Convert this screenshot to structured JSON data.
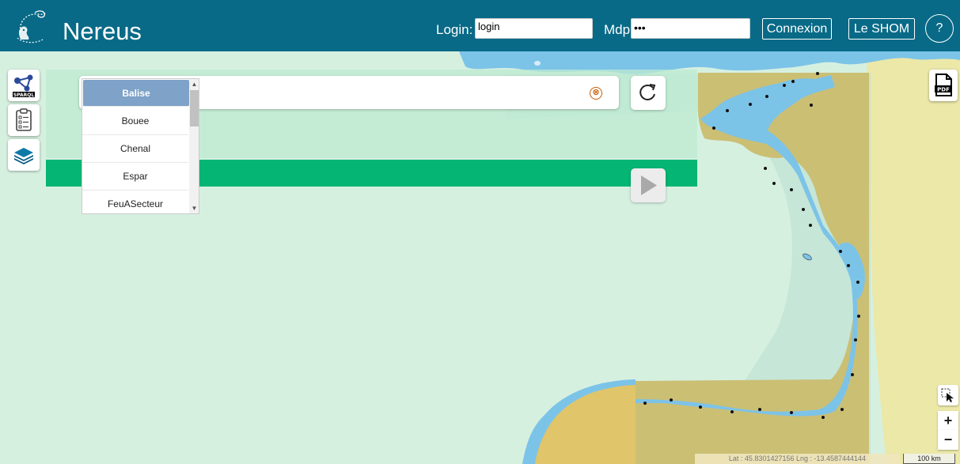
{
  "header": {
    "title": "Nereus",
    "login_label": "Login:",
    "login_value": "login",
    "password_label": "Mdp:",
    "password_value": "•••",
    "connect_button": "Connexion",
    "shom_button": "Le SHOM",
    "help_button": "?"
  },
  "toolbar": {
    "sparql_icon_text": "SPARQL"
  },
  "search": {
    "clear_icon": "⊗",
    "options": [
      "Balise",
      "Bouee",
      "Chenal",
      "Espar",
      "FeuASecteur"
    ],
    "selected": "Balise"
  },
  "pdf_icon_text": "PDF",
  "map_controls": {
    "zoom_in": "+",
    "zoom_out": "−"
  },
  "status": {
    "coords": "Lat : 45.8301427156   Lng : -13.4587444144",
    "scale": "100 km"
  },
  "colors": {
    "header": "#086a87",
    "sea": "#d6f0e0",
    "water": "#7cc3e8",
    "land": "#e9e6a6",
    "overlay_land": "#c9bd72",
    "accent_green": "#04b574",
    "selected_item": "#7ea2c8"
  },
  "icons": [
    "logo-icon",
    "sparql-icon",
    "checklist-icon",
    "layers-icon",
    "clear-icon",
    "refresh-icon",
    "play-icon",
    "pdf-icon",
    "select-area-icon"
  ]
}
